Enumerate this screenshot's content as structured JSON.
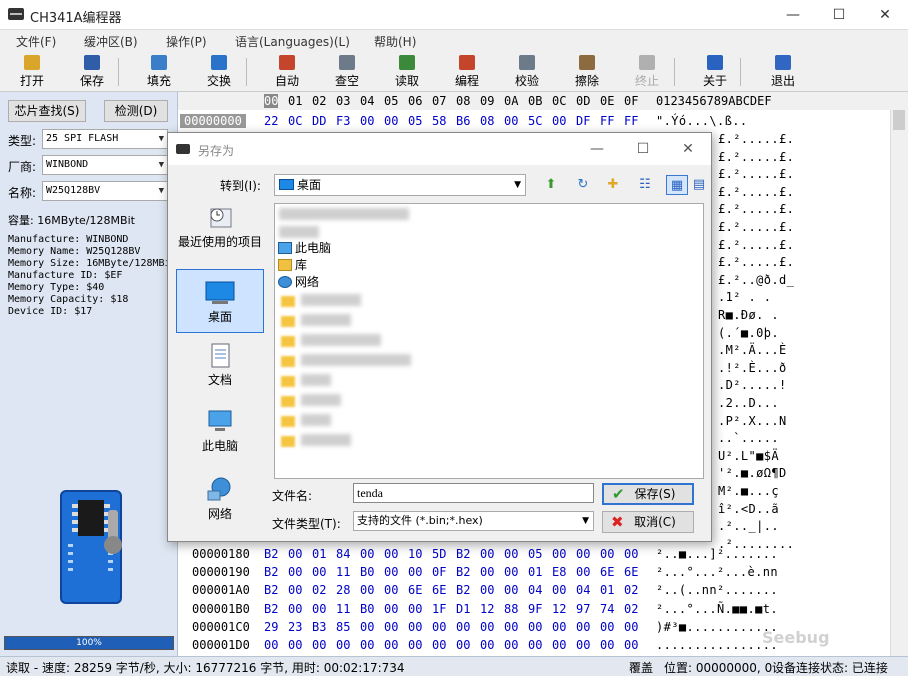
{
  "app": {
    "title": "CH341A编程器",
    "window_controls": [
      "—",
      "☐",
      "✕"
    ]
  },
  "menu": [
    "文件(F)",
    "缓冲区(B)",
    "操作(P)",
    "语言(Languages)(L)",
    "帮助(H)"
  ],
  "toolbar": [
    {
      "label": "打开",
      "icon": "open-folder-icon",
      "color": "#d9a62b"
    },
    {
      "label": "保存",
      "icon": "save-disk-icon",
      "color": "#2f5da8"
    },
    {
      "label": "填充",
      "icon": "fill-pencil-icon",
      "color": "#3a7dc8"
    },
    {
      "label": "交换",
      "icon": "swap-arrows-icon",
      "color": "#2a73c9"
    },
    {
      "label": "自动",
      "icon": "auto-chip-icon",
      "color": "#c4452c"
    },
    {
      "label": "查空",
      "icon": "blank-check-icon",
      "color": "#6c7a89"
    },
    {
      "label": "读取",
      "icon": "read-chip-icon",
      "color": "#3b8a3b"
    },
    {
      "label": "编程",
      "icon": "program-chip-icon",
      "color": "#c4452c"
    },
    {
      "label": "校验",
      "icon": "verify-chip-icon",
      "color": "#6c7a89"
    },
    {
      "label": "擦除",
      "icon": "erase-chip-icon",
      "color": "#8c6c3e"
    },
    {
      "label": "终止",
      "icon": "stop-icon",
      "color": "#b0b0b0",
      "disabled": true
    },
    {
      "label": "关于",
      "icon": "info-icon",
      "color": "#2a62c0"
    },
    {
      "label": "退出",
      "icon": "exit-door-icon",
      "color": "#3167c0"
    }
  ],
  "left": {
    "find_button": "芯片查找(S)",
    "detect_button": "检测(D)",
    "type_label": "类型:",
    "type_value": "25 SPI FLASH",
    "vendor_label": "厂商:",
    "vendor_value": "WINBOND",
    "name_label": "名称:",
    "name_value": "W25Q128BV",
    "capacity": "容量: 16MByte/128MBit",
    "info_lines": [
      "Manufacture: WINBOND",
      "Memory Name: W25Q128BV",
      "Memory Size: 16MByte/128MBit",
      "Manufacture ID: $EF",
      "Memory Type: $40",
      "Memory Capacity: $18",
      "Device ID: $17"
    ],
    "progress_text": "100%",
    "progress_value": 1.0
  },
  "hex": {
    "header_cols": [
      "00",
      "01",
      "02",
      "03",
      "04",
      "05",
      "06",
      "07",
      "08",
      "09",
      "0A",
      "0B",
      "0C",
      "0D",
      "0E",
      "0F"
    ],
    "ascii_header": "0123456789ABCDEF",
    "top_row": {
      "addr": "00000000",
      "bytes": [
        "22",
        "0C",
        "DD",
        "F3",
        "00",
        "00",
        "05",
        "58",
        "B6",
        "08",
        "00",
        "5C",
        "00",
        "DF",
        "FF",
        "FF"
      ],
      "ascii": "\".Ýó...\\.ß.."
    },
    "partial_ascii": [
      "£.².....£.",
      "£.².....£.",
      "£.².....£.",
      "£.².....£.",
      "£.².....£.",
      "£.².....£.",
      "£.².....£.",
      "£.².....£.",
      "£.²..@ð.d_",
      ".1²  .  .",
      "R■.Ðø.  .",
      "(.´■.0þ.",
      ".M².Ä...È",
      ".!².È...ð",
      ".D².....!",
      ".2..D...",
      ".P².X...N",
      "..`.....",
      "U².L\"■$Ä",
      "'².■.øΩ¶D",
      "M².■...ç",
      "î².<D..ã",
      ".².._|..",
      ".²........"
    ],
    "bottom_rows": [
      {
        "addr": "00000180",
        "bytes": [
          "B2",
          "00",
          "01",
          "84",
          "00",
          "00",
          "10",
          "5D",
          "B2",
          "00",
          "00",
          "05",
          "00",
          "00",
          "00",
          "00"
        ],
        "ascii": "²..■...]²......."
      },
      {
        "addr": "00000190",
        "bytes": [
          "B2",
          "00",
          "00",
          "11",
          "B0",
          "00",
          "00",
          "0F",
          "B2",
          "00",
          "00",
          "01",
          "E8",
          "00",
          "6E",
          "6E"
        ],
        "ascii": "²...°...²...è.nn"
      },
      {
        "addr": "000001A0",
        "bytes": [
          "B2",
          "00",
          "02",
          "28",
          "00",
          "00",
          "6E",
          "6E",
          "B2",
          "00",
          "00",
          "04",
          "00",
          "04",
          "01",
          "02"
        ],
        "ascii": "²..(..nn²......."
      },
      {
        "addr": "000001B0",
        "bytes": [
          "B2",
          "00",
          "00",
          "11",
          "B0",
          "00",
          "00",
          "1F",
          "D1",
          "12",
          "88",
          "9F",
          "12",
          "97",
          "74",
          "02"
        ],
        "ascii": "²...°...Ñ.■■.■t."
      },
      {
        "addr": "000001C0",
        "bytes": [
          "29",
          "23",
          "B3",
          "85",
          "00",
          "00",
          "00",
          "00",
          "00",
          "00",
          "00",
          "00",
          "00",
          "00",
          "00",
          "00"
        ],
        "ascii": ")#³■............"
      },
      {
        "addr": "000001D0",
        "bytes": [
          "00",
          "00",
          "00",
          "00",
          "00",
          "00",
          "00",
          "00",
          "00",
          "00",
          "00",
          "00",
          "00",
          "00",
          "00",
          "00"
        ],
        "ascii": "................"
      }
    ]
  },
  "status": {
    "left": "读取 - 速度: 28259 字节/秒, 大小: 16777216 字节, 用时: 00:02:17:734",
    "mode": "覆盖",
    "position": "位置: 00000000, 0",
    "device": "设备连接状态: 已连接"
  },
  "watermark": "Seebug",
  "dialog": {
    "title": "另存为",
    "lookin_label": "转到(I):",
    "lookin_value": "桌面",
    "places": [
      "最近使用的项目",
      "桌面",
      "文档",
      "此电脑",
      "网络"
    ],
    "files": [
      {
        "label": "此电脑",
        "icon": "computer-icon"
      },
      {
        "label": "库",
        "icon": "library-icon"
      },
      {
        "label": "网络",
        "icon": "network-icon"
      }
    ],
    "filename_label": "文件名:",
    "filename_value": "tenda",
    "filetype_label": "文件类型(T):",
    "filetype_value": "支持的文件 (*.bin;*.hex)",
    "save_button": "保存(S)",
    "cancel_button": "取消(C)"
  }
}
